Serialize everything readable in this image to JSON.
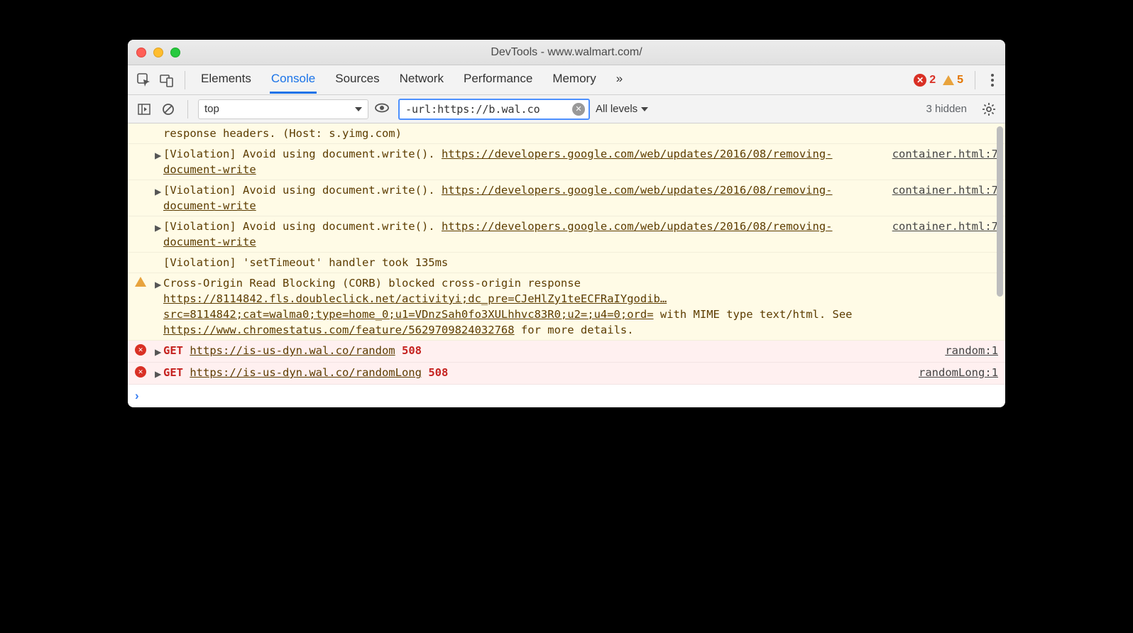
{
  "window": {
    "title": "DevTools - www.walmart.com/"
  },
  "header": {
    "tabs": [
      "Elements",
      "Console",
      "Sources",
      "Network",
      "Performance",
      "Memory"
    ],
    "activeTab": "Console",
    "more": "»",
    "errorCount": "2",
    "warnCount": "5"
  },
  "toolbar": {
    "context": "top",
    "filter": "-url:https://b.wal.co",
    "levels": "All levels",
    "hidden": "3 hidden"
  },
  "rows": {
    "partial": {
      "text": "response headers. (Host: s.yimg.com)"
    },
    "v1": {
      "msg": "[Violation] Avoid using document.write(). ",
      "link1": "https://developers.google.com/web/updates/2016/08/removing-document-write",
      "source": "container.html:7"
    },
    "v2": {
      "msg": "[Violation] Avoid using document.write(). ",
      "link1": "https://developers.google.com/web/updates/2016/08/removing-document-write",
      "source": "container.html:7"
    },
    "v3": {
      "msg": "[Violation] Avoid using document.write(). ",
      "link1": "https://developers.google.com/web/updates/2016/08/removing-document-write",
      "source": "container.html:7"
    },
    "v4": {
      "msg": "[Violation] 'setTimeout' handler took 135ms"
    },
    "corb": {
      "pre": "Cross-Origin Read Blocking (CORB) blocked cross-origin response ",
      "url1": "https://8114842.fls.doubleclick.net/activityi;dc_pre=CJeHlZy1teECFRaIYgodib…src=8114842;cat=walma0;type=home_0;u1=VDnzSah0fo3XULhhvc83R0;u2=;u4=0;ord=",
      "mid": " with MIME type text/html. See ",
      "url2": "https://www.chromestatus.com/feature/5629709824032768",
      "post": " for more details."
    },
    "e1": {
      "method": "GET",
      "url": "https://is-us-dyn.wal.co/random",
      "status": "508",
      "source": "random:1"
    },
    "e2": {
      "method": "GET",
      "url": "https://is-us-dyn.wal.co/randomLong",
      "status": "508",
      "source": "randomLong:1"
    }
  }
}
